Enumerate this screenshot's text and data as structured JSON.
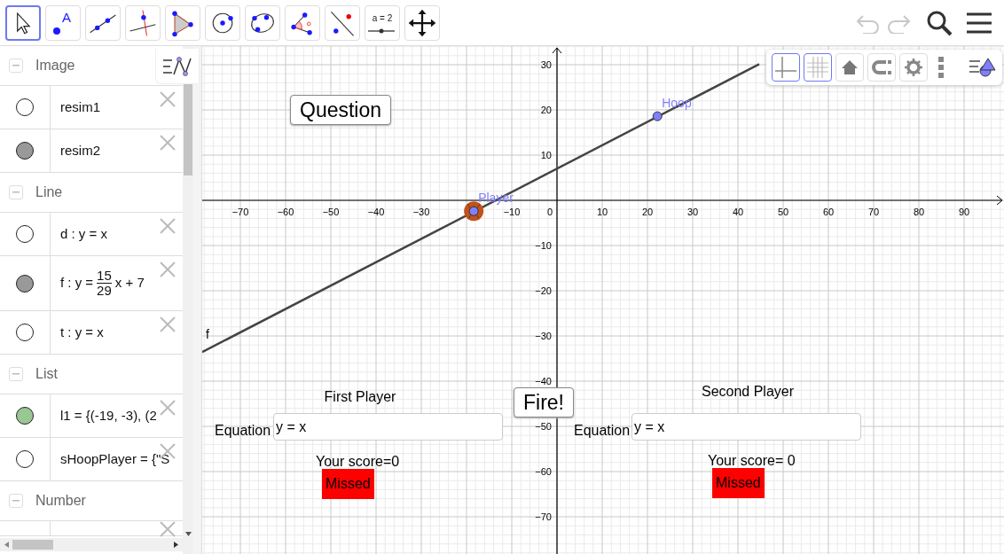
{
  "toolbar": {
    "tools": [
      {
        "kind": "move",
        "selected": true
      },
      {
        "kind": "point",
        "label": "A",
        "selected": false
      },
      {
        "kind": "line",
        "selected": false
      },
      {
        "kind": "perpendicular",
        "selected": false
      },
      {
        "kind": "polygon",
        "selected": false
      },
      {
        "kind": "circle",
        "selected": false
      },
      {
        "kind": "conic",
        "selected": false
      },
      {
        "kind": "angle",
        "selected": false
      },
      {
        "kind": "reflect",
        "selected": false
      },
      {
        "kind": "slider",
        "label": "a = 2",
        "selected": false
      },
      {
        "kind": "move-view",
        "selected": false
      }
    ],
    "undo": {
      "disabled": true
    },
    "redo": {
      "disabled": true
    }
  },
  "algebra": {
    "groups": [
      {
        "title": "Image",
        "items": [
          {
            "text": "resim1",
            "visible": false
          },
          {
            "text": "resim2",
            "visible": true,
            "color": "#999999"
          }
        ]
      },
      {
        "title": "Line",
        "items": [
          {
            "text": "d : y = x",
            "visible": false
          },
          {
            "kind": "fraction",
            "text": "f : y =",
            "numerator": "15",
            "denominator": "29",
            "suffix": "x + 7",
            "visible": true,
            "color": "#999999"
          },
          {
            "text": "t : y = x",
            "visible": false
          }
        ]
      },
      {
        "title": "List",
        "items": [
          {
            "text": "l1 = {(-19, -3), (2",
            "visible": true,
            "color": "#99c794"
          },
          {
            "text": "sHoopPlayer = {\"S",
            "visible": false
          }
        ]
      },
      {
        "title": "Number",
        "items": [
          {
            "kind": "cut"
          }
        ]
      }
    ]
  },
  "graphics": {
    "style_bar": {
      "axes": {
        "selected": true
      },
      "grid": {
        "selected": true
      }
    },
    "x_ticks": [
      "−70",
      "−60",
      "−50",
      "−40",
      "−30",
      "−10",
      "0",
      "10",
      "20",
      "30",
      "40",
      "50",
      "60",
      "70",
      "80",
      "90"
    ],
    "y_ticks": [
      "30",
      "20",
      "10",
      "−10",
      "−20",
      "−30",
      "−40",
      "−50",
      "−60",
      "−70"
    ],
    "line_label": "f",
    "points": [
      {
        "label": "Hoop"
      },
      {
        "label": "Player"
      }
    ],
    "buttons": [
      "Question",
      "Fire!"
    ],
    "players": [
      {
        "title": "First Player",
        "equation_label": "Equation",
        "equation": "y = x",
        "score": "Your score=0",
        "result": "Missed"
      },
      {
        "title": "Second Player",
        "equation_label": "Equation",
        "equation": "y = x",
        "score": "Your score= 0",
        "result": "Missed"
      }
    ]
  }
}
